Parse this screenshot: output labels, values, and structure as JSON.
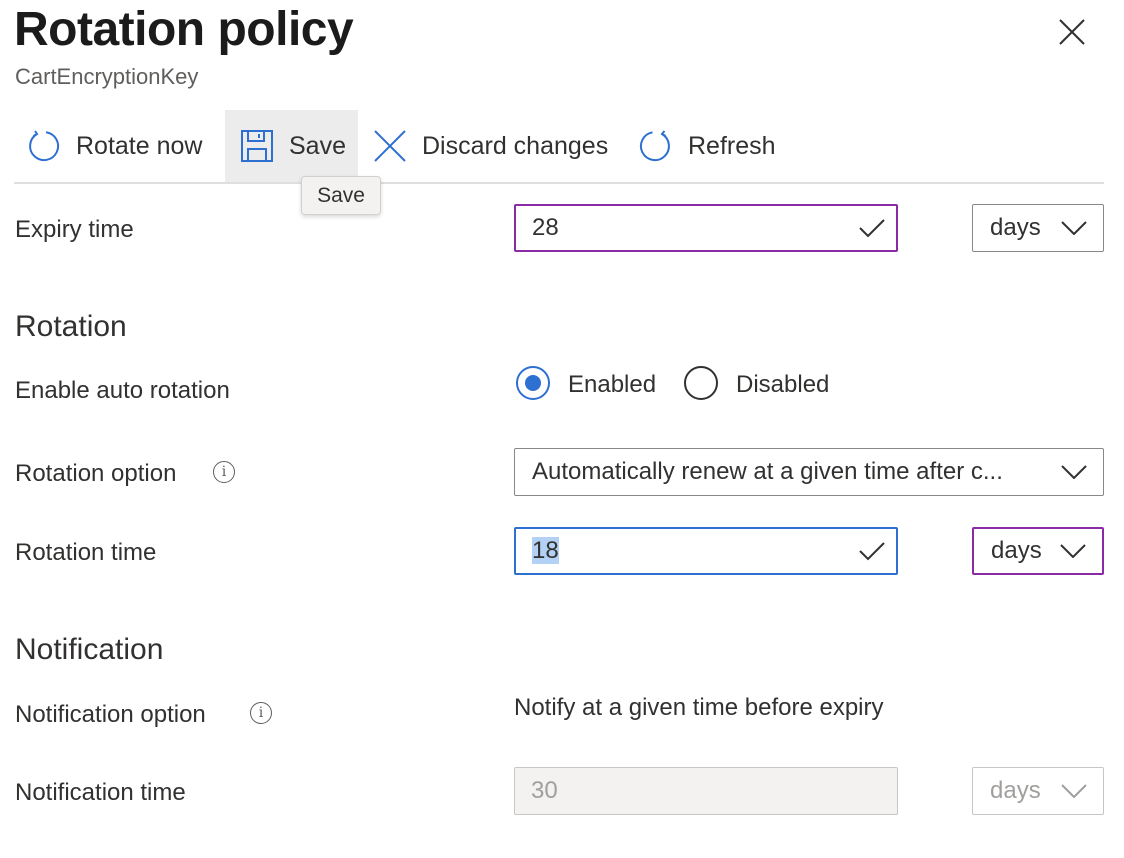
{
  "header": {
    "title": "Rotation policy",
    "subtitle": "CartEncryptionKey",
    "close_icon": "close-icon"
  },
  "toolbar": {
    "rotate_now": "Rotate now",
    "save": "Save",
    "discard": "Discard changes",
    "refresh": "Refresh",
    "tooltip": "Save"
  },
  "expiry": {
    "label": "Expiry time",
    "value": "28",
    "unit": "days"
  },
  "rotation": {
    "heading": "Rotation",
    "auto_label": "Enable auto rotation",
    "enabled_label": "Enabled",
    "disabled_label": "Disabled",
    "selected": "Enabled",
    "option_label": "Rotation option",
    "option_value": "Automatically renew at a given time after c...",
    "time_label": "Rotation time",
    "time_value": "18",
    "time_unit": "days"
  },
  "notification": {
    "heading": "Notification",
    "option_label": "Notification option",
    "option_value": "Notify at a given time before expiry",
    "time_label": "Notification time",
    "time_value": "30",
    "time_unit": "days"
  },
  "colors": {
    "accent": "#2e6fd2",
    "focus_border": "#8a2aa4"
  }
}
